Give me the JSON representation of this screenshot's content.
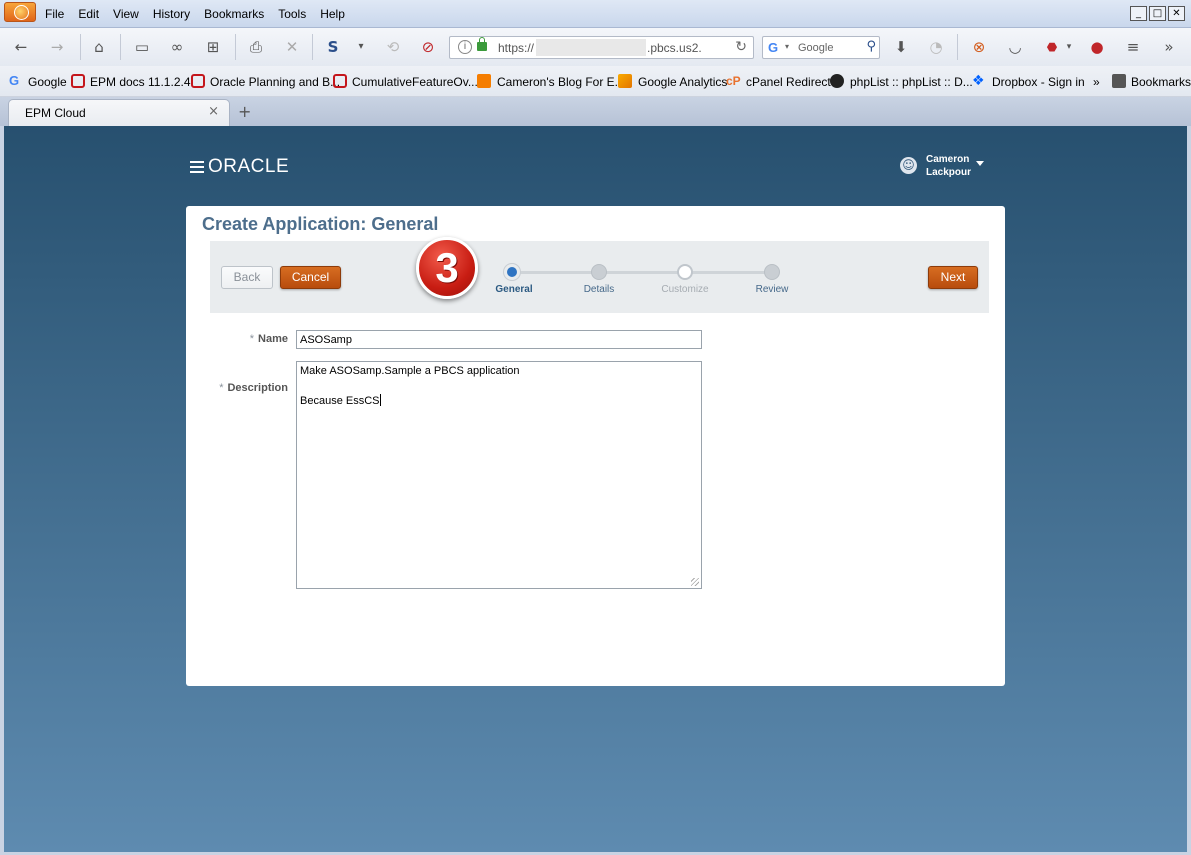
{
  "browser": {
    "menu": [
      "File",
      "Edit",
      "View",
      "History",
      "Bookmarks",
      "Tools",
      "Help"
    ],
    "window_controls": [
      "minimize",
      "maximize",
      "close"
    ],
    "url_prefix": "https://",
    "url_suffix": ".pbcs.us2.",
    "search_engine": "Google",
    "search_placeholder": "Google",
    "bookmarks": [
      {
        "label": "Google",
        "icon": "google-icon"
      },
      {
        "label": "EPM docs 11.1.2.4",
        "icon": "oracle-icon"
      },
      {
        "label": "Oracle Planning and B...",
        "icon": "oracle-icon"
      },
      {
        "label": "CumulativeFeatureOv...",
        "icon": "oracle-icon"
      },
      {
        "label": "Cameron's Blog For E...",
        "icon": "blogger-icon"
      },
      {
        "label": "Google Analytics",
        "icon": "analytics-icon"
      },
      {
        "label": "cPanel Redirect",
        "icon": "cpanel-icon"
      },
      {
        "label": "phpList :: phpList :: D...",
        "icon": "phplist-icon"
      },
      {
        "label": "Dropbox - Sign in",
        "icon": "dropbox-icon"
      },
      {
        "label": "Bookmarks",
        "icon": "bookmarks-icon"
      }
    ],
    "overflow": "»",
    "tab_title": "EPM Cloud",
    "tab_close": "×",
    "new_tab": "+"
  },
  "app": {
    "logo": "ORACLE",
    "user_first": "Cameron",
    "user_last": "Lackpour",
    "page_title": "Create Application: General",
    "back_label": "Back",
    "cancel_label": "Cancel",
    "next_label": "Next",
    "step_badge": "3",
    "steps": [
      {
        "label": "General",
        "state": "active"
      },
      {
        "label": "Details",
        "state": "normal"
      },
      {
        "label": "Customize",
        "state": "disabled"
      },
      {
        "label": "Review",
        "state": "normal"
      }
    ],
    "name_label": "Name",
    "name_value": "ASOSamp",
    "description_label": "Description",
    "description_lines": [
      "Make ASOSamp.Sample a PBCS application",
      "",
      "Because EssCS"
    ],
    "required_marker": "*"
  },
  "colors": {
    "accent_orange": "#c45a14",
    "title_blue": "#4d6e8c",
    "active_step": "#2f74c2"
  }
}
